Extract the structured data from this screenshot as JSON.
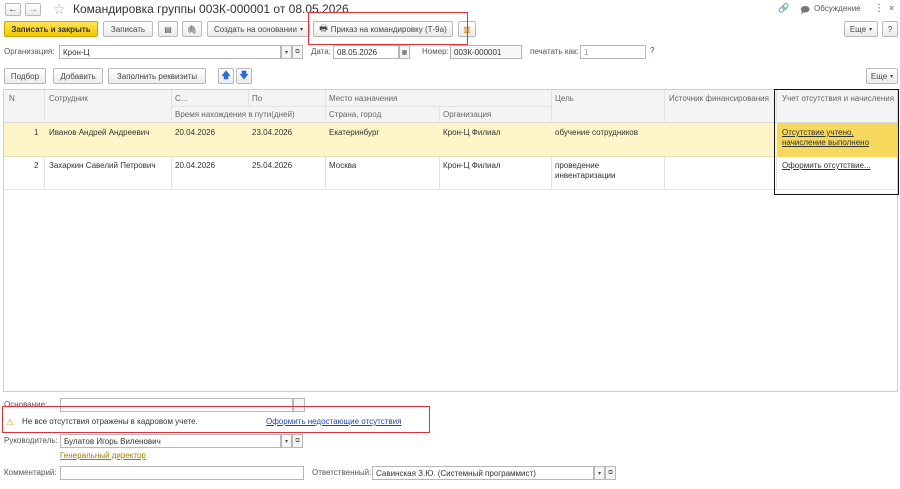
{
  "window": {
    "title": "Командировка группы 003К-000001 от 08.05.2026",
    "discussion_label": "Обсуждение"
  },
  "toolbar": {
    "save_close": "Записать и закрыть",
    "save": "Записать",
    "create_basis": "Создать на основании",
    "print_order": "Приказ на командировку (Т-9а)",
    "more": "Еще",
    "help": "?"
  },
  "org_row": {
    "org_label": "Организация:",
    "org_value": "Крон-Ц",
    "date_label": "Дата:",
    "date_value": "08.05.2026",
    "number_label": "Номер:",
    "number_value": "003К-000001",
    "print_as_label": "печатать как:",
    "print_as_value": "1",
    "help": "?"
  },
  "table_toolbar": {
    "select": "Подбор",
    "add": "Добавить",
    "fill": "Заполнить реквизиты",
    "more": "Еще"
  },
  "table": {
    "headers": {
      "n": "N",
      "employee": "Сотрудник",
      "from": "С...",
      "to": "По",
      "destination": "Место назначения",
      "purpose": "Цель",
      "funding": "Источник финансирования",
      "absence": "Учет отсутствия и начисления",
      "travel_time": "Время нахождения в пути(дней)",
      "country_city": "Страна, город",
      "organization": "Организация"
    },
    "rows": [
      {
        "n": "1",
        "employee": "Иванов Андрей Андреевич",
        "from": "20.04.2026",
        "to": "23.04.2026",
        "city": "Екатеринбург",
        "org": "Крон-Ц Филиал",
        "purpose_1": "обучение сотрудников",
        "purpose_2": "",
        "absence_1": "Отсутствие учтено,",
        "absence_2": "начисление выполнено"
      },
      {
        "n": "2",
        "employee": "Захаркин Савелий Петрович",
        "from": "20.04.2026",
        "to": "25.04.2026",
        "city": "Москва",
        "org": "Крон-Ц Филиал",
        "purpose_1": "проведение",
        "purpose_2": "инвентаризации",
        "absence_1": "Оформить отсутствие...",
        "absence_2": ""
      }
    ]
  },
  "footer": {
    "basis_label": "Основание:",
    "basis_value": "",
    "warning_text": "Не все отсутствия отражены в кадровом учете.",
    "warning_link": "Оформить недостающие отсутствия",
    "manager_label": "Руководитель:",
    "manager_value": "Булатов Игорь Виленович",
    "manager_position": "Генеральный директор",
    "comment_label": "Комментарий:",
    "comment_value": "",
    "responsible_label": "Ответственный:",
    "responsible_value": "Савинская З.Ю. (Системный программист)"
  },
  "colors": {
    "accent_yellow": "#f5c800",
    "selected_row": "#fdf5c8",
    "highlight_red": "#e0303a",
    "link_blue": "#1a45b0"
  }
}
